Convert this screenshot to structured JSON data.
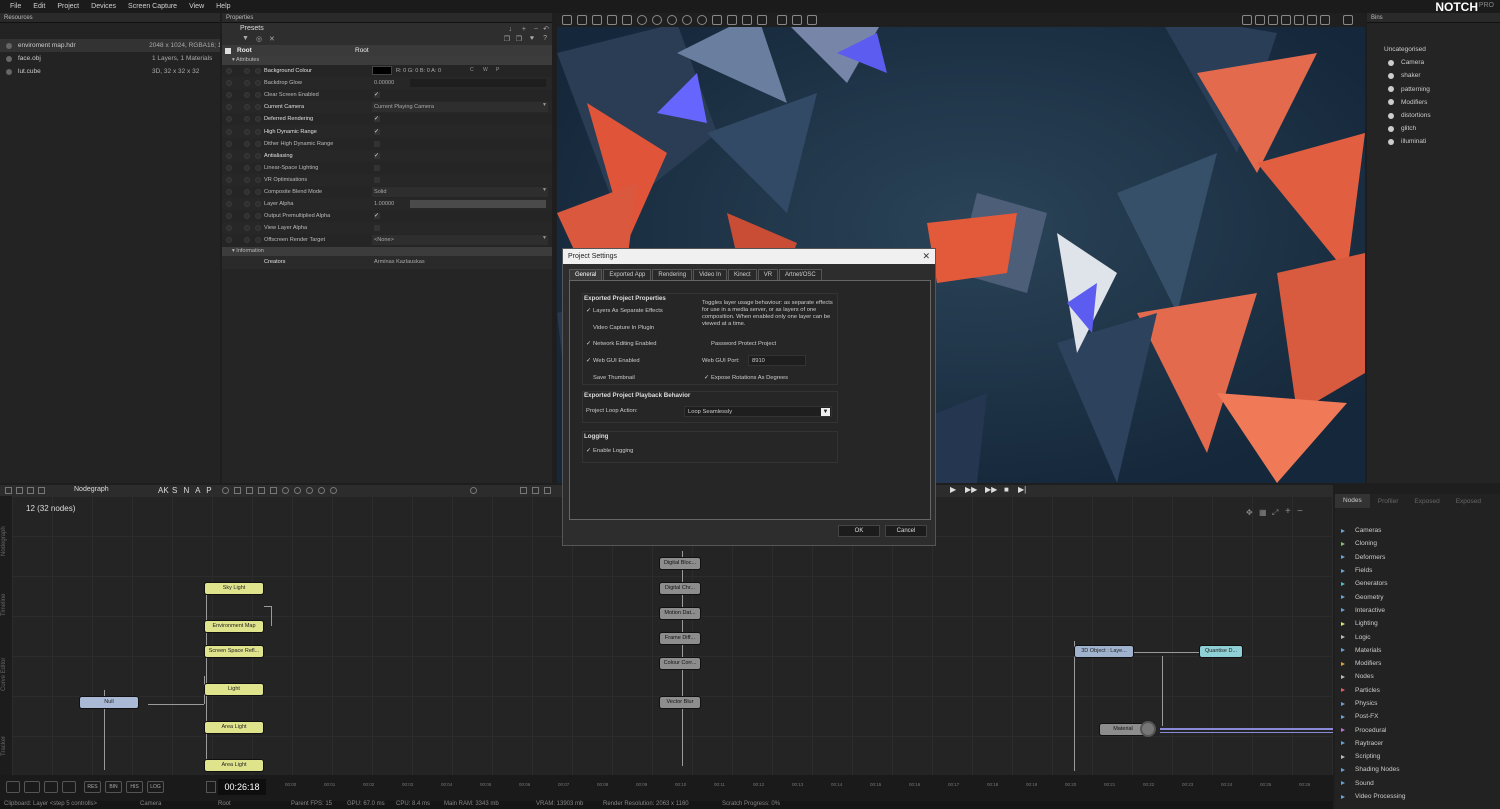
{
  "menu": [
    "File",
    "Edit",
    "Project",
    "Devices",
    "Screen Capture",
    "View",
    "Help"
  ],
  "logo": "NOTCH",
  "logo_suffix": "PRO",
  "resources": {
    "title": "Resources",
    "items": [
      {
        "name": "enviroment map.hdr",
        "info": "2048 x 1024, RGBA16; 1"
      },
      {
        "name": "face.obj",
        "info": "1 Layers, 1 Materials"
      },
      {
        "name": "lut.cube",
        "info": "3D, 32 x 32 x 32"
      }
    ]
  },
  "properties": {
    "title": "Properties",
    "presets": "Presets",
    "root_label": "Root",
    "root_value": "Root",
    "section_attributes": "Attributes",
    "section_information": "Information",
    "rows": [
      {
        "label": "Background Colour",
        "value": "R: 0 G: 0 B: 0 A: 0",
        "type": "color",
        "bright": true
      },
      {
        "label": "Backdrop Glow",
        "value": "0.00000",
        "type": "slider",
        "bright": false
      },
      {
        "label": "Clear Screen Enabled",
        "value": "✓",
        "type": "check",
        "bright": false
      },
      {
        "label": "Current Camera",
        "value": "Current Playing Camera",
        "type": "select",
        "bright": true
      },
      {
        "label": "Deferred Rendering",
        "value": "✓",
        "type": "check",
        "bright": true
      },
      {
        "label": "High Dynamic Range",
        "value": "✓",
        "type": "check",
        "bright": true
      },
      {
        "label": "Dither High Dynamic Range",
        "value": "",
        "type": "check",
        "bright": false
      },
      {
        "label": "Antialiasing",
        "value": "✓",
        "type": "check",
        "bright": true
      },
      {
        "label": "Linear-Space Lighting",
        "value": "",
        "type": "check",
        "bright": false
      },
      {
        "label": "VR Optimisations",
        "value": "",
        "type": "check",
        "bright": false
      },
      {
        "label": "Composite Blend Mode",
        "value": "Solid",
        "type": "select",
        "bright": false
      },
      {
        "label": "Layer Alpha",
        "value": "1.00000",
        "type": "slider",
        "bright": false
      },
      {
        "label": "Output Premultiplied Alpha",
        "value": "✓",
        "type": "check",
        "bright": false
      },
      {
        "label": "View Layer Alpha",
        "value": "",
        "type": "check",
        "bright": false
      },
      {
        "label": "Offscreen Render Target",
        "value": "<None>",
        "type": "select",
        "bright": false
      }
    ],
    "creators_label": "Creators",
    "creators_value": "Arminas Kazlauskas",
    "color_buttons": [
      "C",
      "W",
      "P"
    ]
  },
  "bins": {
    "title": "Bins",
    "root": "Uncategorised",
    "items": [
      "Camera",
      "shaker",
      "patterning",
      "Modifiers",
      "distortions",
      "glitch",
      "illuminati"
    ]
  },
  "nodegraph": {
    "title": "Nodegraph",
    "snap_label": "S N A P",
    "count": "12  (32  nodes)",
    "side_tabs": [
      "Nodegraph",
      "Timeline",
      "Curve Editor",
      "Tracker"
    ],
    "nodes": {
      "sky": "Sky  Light",
      "env": "Environment  Map",
      "ssr": "Screen  Space  Refl...",
      "light": "Light",
      "area1": "Area  Light",
      "area2": "Area  Light",
      "null": "Null",
      "digital_bloc": "Digital  Bloc...",
      "digital_chr": "Digital  Chr...",
      "motion": "Motion  Dat...",
      "frame": "Frame  Diff...",
      "colour": "Colour  Corr...",
      "vector": "Vector  Blur",
      "obj3d": "3D  Object  :  Laye...",
      "quantise": "Quantise  D...",
      "material": "Material"
    }
  },
  "nodes_panel": {
    "tabs": [
      "Nodes",
      "Profiler",
      "Exposed",
      "Exposed"
    ],
    "items": [
      {
        "name": "Cameras",
        "color": "#6aa0d8"
      },
      {
        "name": "Cloning",
        "color": "#8fc06a"
      },
      {
        "name": "Deformers",
        "color": "#6aa0d8"
      },
      {
        "name": "Fields",
        "color": "#6aa0d8"
      },
      {
        "name": "Generators",
        "color": "#4fc0c0"
      },
      {
        "name": "Geometry",
        "color": "#6aa0d8"
      },
      {
        "name": "Interactive",
        "color": "#6aa0d8"
      },
      {
        "name": "Lighting",
        "color": "#e0e070"
      },
      {
        "name": "Logic",
        "color": "#bbbbbb"
      },
      {
        "name": "Materials",
        "color": "#6aa0d8"
      },
      {
        "name": "Modifiers",
        "color": "#e0a040"
      },
      {
        "name": "Nodes",
        "color": "#bbbbbb"
      },
      {
        "name": "Particles",
        "color": "#e06060"
      },
      {
        "name": "Physics",
        "color": "#6aa0d8"
      },
      {
        "name": "Post-FX",
        "color": "#6aa0d8"
      },
      {
        "name": "Procedural",
        "color": "#c070d0"
      },
      {
        "name": "Raytracer",
        "color": "#6aa0d8"
      },
      {
        "name": "Scripting",
        "color": "#bbbbbb"
      },
      {
        "name": "Shading Nodes",
        "color": "#6aa0d8"
      },
      {
        "name": "Sound",
        "color": "#6aa0d8"
      },
      {
        "name": "Video Processing",
        "color": "#6aa0d8"
      }
    ]
  },
  "timeline": {
    "timecode": "00:26:18",
    "buttons": [
      "RES",
      "BIN",
      "HIS",
      "LOG"
    ],
    "ticks": [
      "00:00",
      "00:01",
      "00:02",
      "00:03",
      "00:04",
      "00:05",
      "00:06",
      "00:07",
      "00:08",
      "00:09",
      "00:10",
      "00:11",
      "00:12",
      "00:13",
      "00:14",
      "00:15",
      "00:16",
      "00:17",
      "00:18",
      "00:19",
      "00:20",
      "00:21",
      "00:22",
      "00:23",
      "00:24",
      "00:25",
      "00:26"
    ]
  },
  "status": {
    "clipboard": "Clipboard: Layer <step 5 controlls>",
    "camera": "Camera",
    "root": "Root",
    "parent_fps": "Parent FPS: 15",
    "gpu": "GPU: 67.0 ms",
    "cpu": "CPU: 8.4 ms",
    "main_ram": "Main RAM: 3343 mb",
    "vram": "VRAM: 13903 mb",
    "render_res": "Render Resolution: 2063 x 1160",
    "scratch": "Scratch Progress: 0%"
  },
  "dialog": {
    "title": "Project Settings",
    "tabs": [
      "General",
      "Exported App",
      "Rendering",
      "Video In",
      "Kinect",
      "VR",
      "Artnet/OSC"
    ],
    "group1_title": "Exported Project Properties",
    "layers_separate": "Layers As Separate Effects",
    "help_text": "Toggles layer usage behaviour: as separate effects for use in a media server, or as layers of one composition. When enabled only one layer can be viewed at a time.",
    "video_capture": "Video Capture In Plugin",
    "network_editing": "Network Editing Enabled",
    "password_protect": "Password Protect Project",
    "web_gui": "Web GUI Enabled",
    "web_gui_port_label": "Web GUI Port:",
    "web_gui_port_value": "8910",
    "save_thumbnail": "Save Thumbnail",
    "expose_rotations": "Expose Rotations As Degrees",
    "group2_title": "Exported Project Playback Behavior",
    "loop_label": "Project Loop Action:",
    "loop_value": "Loop Seamlessly",
    "group3_title": "Logging",
    "enable_logging": "Enable Logging",
    "ok": "OK",
    "cancel": "Cancel",
    "check": "✓"
  }
}
